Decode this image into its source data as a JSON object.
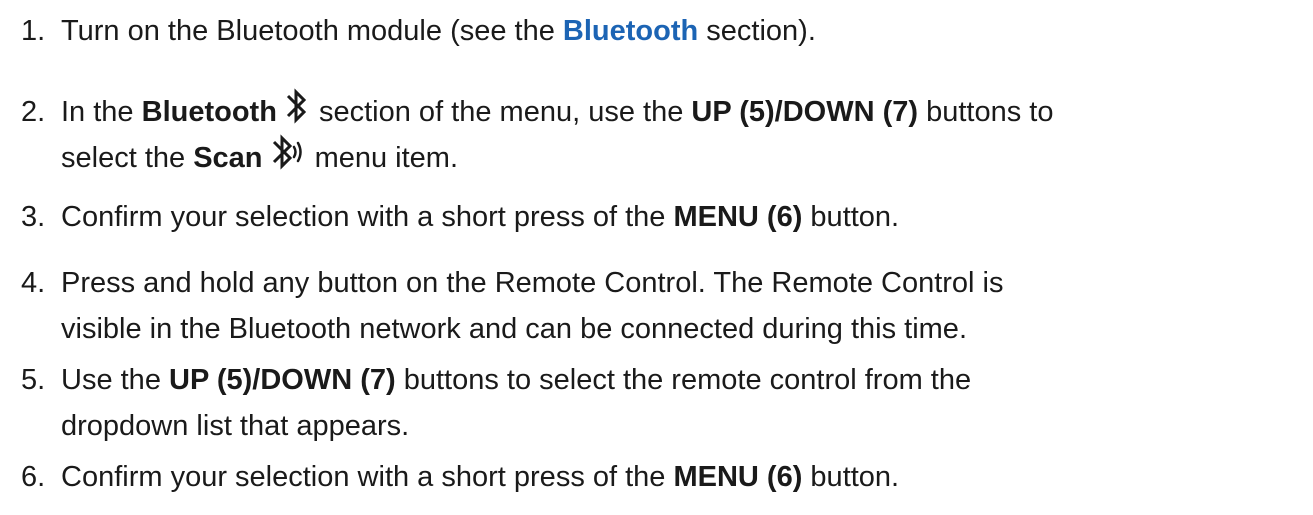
{
  "steps": [
    {
      "number": "1.",
      "lines": [
        [
          {
            "text": "Turn on the Bluetooth module (see the "
          },
          {
            "text": "Bluetooth"
          },
          {
            "text": " section)."
          }
        ]
      ]
    },
    {
      "number": "2.",
      "lines": [
        [
          {
            "text": "In the "
          },
          {
            "text": "Bluetooth"
          },
          {
            "icon": "bluetooth-icon"
          },
          {
            "text": " section of the menu, use the "
          },
          {
            "text": "UP (5)/DOWN (7)"
          },
          {
            "text": " buttons to"
          }
        ],
        [
          {
            "text": "select the "
          },
          {
            "text": "Scan"
          },
          {
            "icon": "bluetooth-scan-icon"
          },
          {
            "text": " menu item."
          }
        ]
      ]
    },
    {
      "number": "3.",
      "lines": [
        [
          {
            "text": "Confirm your selection with a short press of the "
          },
          {
            "text": "MENU (6)"
          },
          {
            "text": " button."
          }
        ]
      ]
    },
    {
      "number": "4.",
      "lines": [
        [
          {
            "text": "Press and hold any button on the Remote Control. The Remote Control is"
          }
        ],
        [
          {
            "text": "visible in the Bluetooth network and can be connected during this time."
          }
        ]
      ]
    },
    {
      "number": "5.",
      "lines": [
        [
          {
            "text": "Use the "
          },
          {
            "text": "UP (5)/DOWN (7)"
          },
          {
            "text": " buttons to select the remote control from the"
          }
        ],
        [
          {
            "text": "dropdown list that appears."
          }
        ]
      ]
    },
    {
      "number": "6.",
      "lines": [
        [
          {
            "text": "Confirm your selection with a short press of the "
          },
          {
            "text": "MENU (6)"
          },
          {
            "text": " button."
          }
        ]
      ]
    }
  ],
  "colors": {
    "text": "#1a1a1a",
    "link": "#1c64b4"
  }
}
